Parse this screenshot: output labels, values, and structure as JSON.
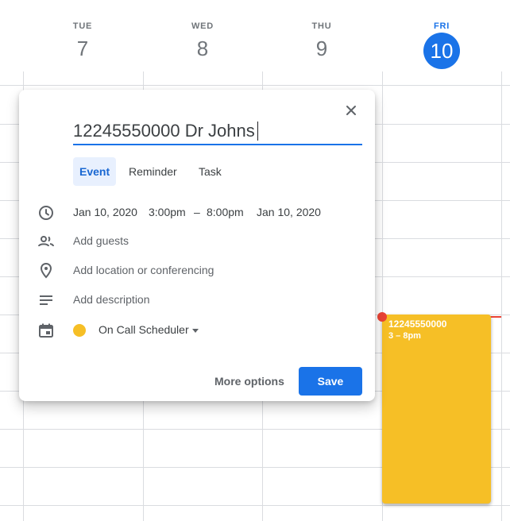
{
  "days": [
    {
      "dow": "TUE",
      "num": "7"
    },
    {
      "dow": "WED",
      "num": "8"
    },
    {
      "dow": "THU",
      "num": "9"
    },
    {
      "dow": "FRI",
      "num": "10"
    }
  ],
  "calendar_event": {
    "title": "12245550000",
    "time": "3 – 8pm",
    "color": "#f6bf26"
  },
  "dialog": {
    "title_value": "12245550000 Dr Johns",
    "tabs": [
      "Event",
      "Reminder",
      "Task"
    ],
    "datetime": {
      "start_date": "Jan 10, 2020",
      "start_time": "3:00pm",
      "dash": "–",
      "end_time": "8:00pm",
      "end_date": "Jan 10, 2020"
    },
    "add_guests": "Add guests",
    "add_location": "Add location or conferencing",
    "add_description": "Add description",
    "calendar_name": "On Call Scheduler",
    "more_options": "More options",
    "save": "Save"
  },
  "icons": [
    "close-icon",
    "clock-icon",
    "people-icon",
    "location-pin-icon",
    "description-icon",
    "calendar-icon",
    "dropdown-caret-icon"
  ],
  "colors": {
    "accent": "#1a73e8",
    "event": "#f6bf26",
    "now_line": "#ea4335"
  }
}
